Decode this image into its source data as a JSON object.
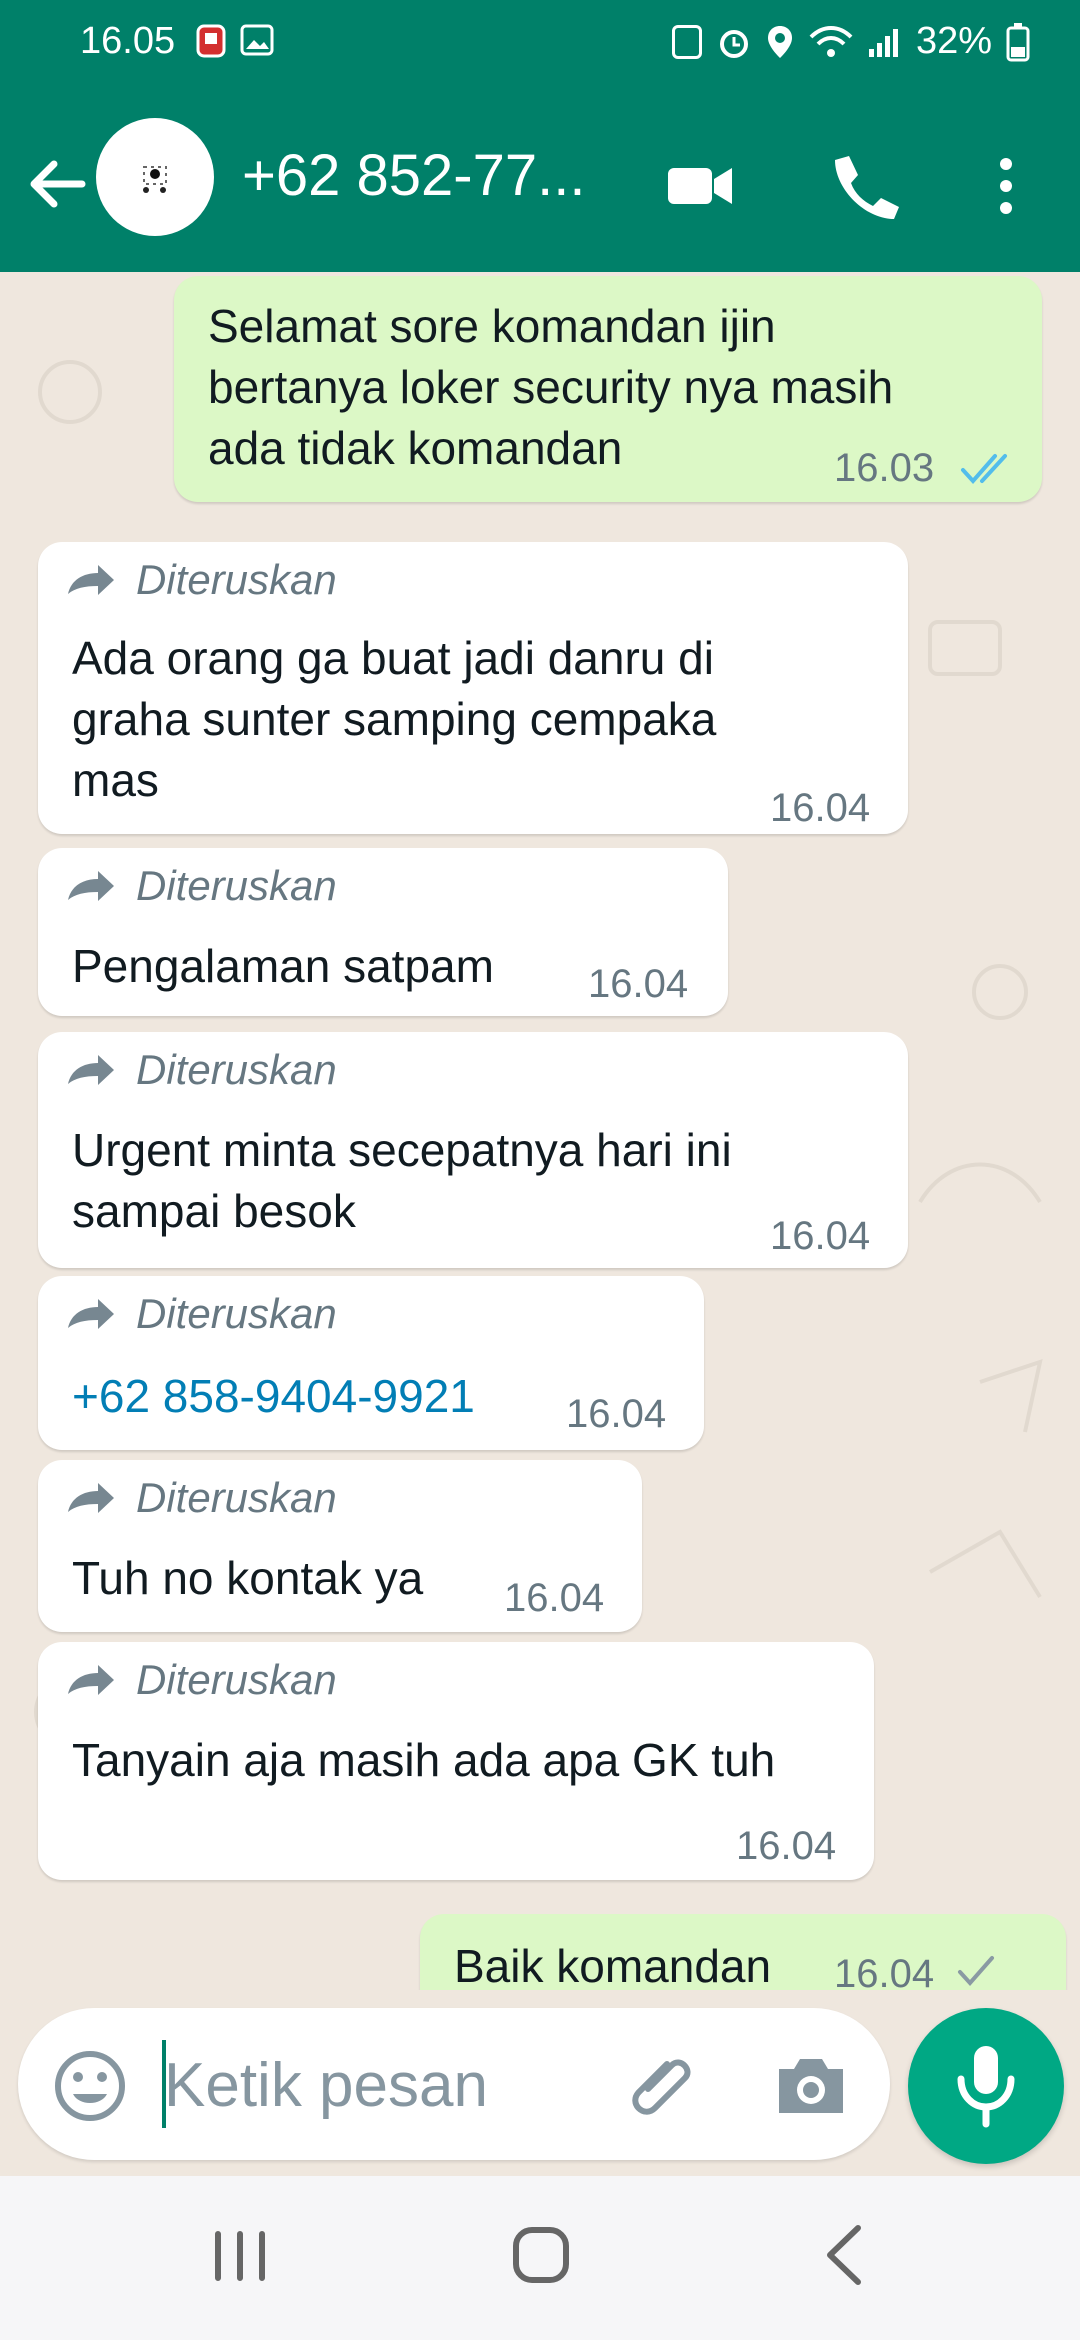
{
  "status_bar": {
    "time": "16.05",
    "battery": "32%"
  },
  "header": {
    "contact": "+62 852-77..."
  },
  "messages": [
    {
      "text": "Selamat sore komandan ijin bertanya loker security nya masih ada tidak komandan",
      "line1": "Selamat sore komandan ijin",
      "line2": "bertanya loker security nya masih",
      "line3": "ada tidak komandan",
      "time": "16.03",
      "direction": "outgoing",
      "status": "read"
    },
    {
      "forwarded": "Diteruskan",
      "text": "Ada orang ga buat jadi danru di graha sunter samping cempaka mas",
      "line1": "Ada orang ga buat jadi danru di",
      "line2": "graha sunter samping cempaka",
      "line3": "mas",
      "time": "16.04",
      "direction": "incoming"
    },
    {
      "forwarded": "Diteruskan",
      "text": "Pengalaman satpam",
      "time": "16.04",
      "direction": "incoming"
    },
    {
      "forwarded": "Diteruskan",
      "text": "Urgent minta secepatnya hari ini sampai besok",
      "line1": "Urgent minta secepatnya hari ini",
      "line2": "sampai besok",
      "time": "16.04",
      "direction": "incoming"
    },
    {
      "forwarded": "Diteruskan",
      "text": "+62 858-9404-9921",
      "time": "16.04",
      "direction": "incoming"
    },
    {
      "forwarded": "Diteruskan",
      "text": "Tuh no kontak ya",
      "time": "16.04",
      "direction": "incoming"
    },
    {
      "forwarded": "Diteruskan",
      "text": "Tanyain aja masih ada apa GK tuh",
      "time": "16.04",
      "direction": "incoming"
    },
    {
      "text": "Baik komandan",
      "time": "16.04",
      "direction": "outgoing",
      "status": "sent"
    }
  ],
  "composer": {
    "placeholder": "Ketik pesan"
  },
  "colors": {
    "header": "#008069",
    "chat_background": "#efe7de",
    "outgoing_bubble": "#dcf8c6",
    "incoming_bubble": "#ffffff",
    "accent": "#00a884",
    "link": "#027eb5",
    "read_ticks": "#53bdeb"
  },
  "icons": [
    "back-arrow-icon",
    "avatar-icon",
    "video-call-icon",
    "voice-call-icon",
    "more-options-icon",
    "forward-icon",
    "double-check-icon",
    "emoji-icon",
    "attach-icon",
    "camera-icon",
    "microphone-icon",
    "recent-apps-icon",
    "home-icon",
    "nav-back-icon"
  ]
}
